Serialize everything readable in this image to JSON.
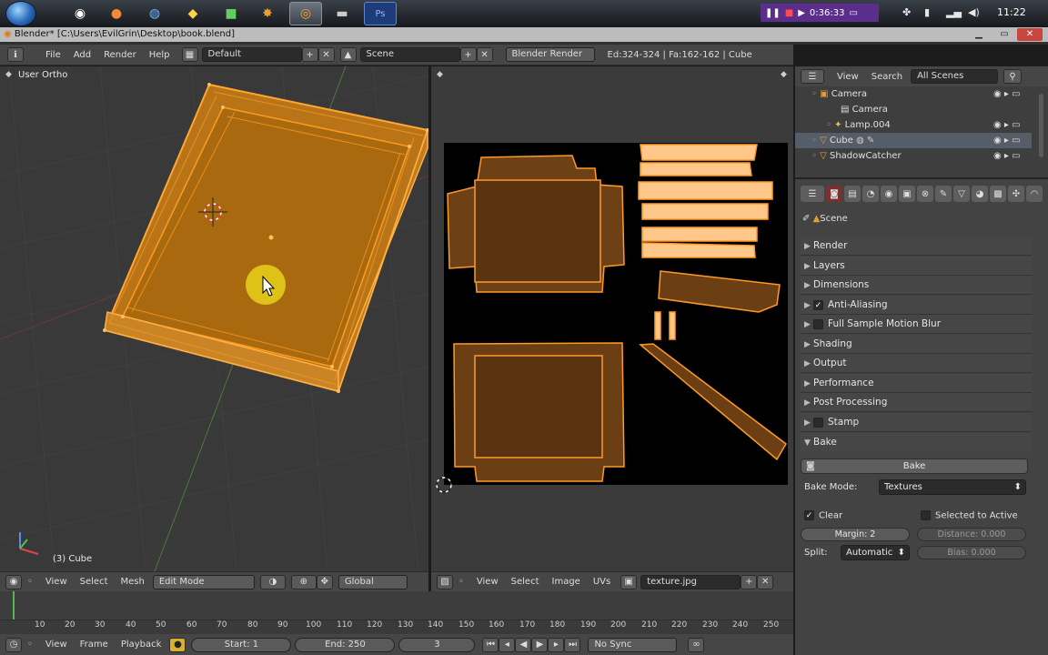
{
  "taskbar": {
    "apps": [
      "chrome-icon",
      "firefox-icon",
      "globe-icon",
      "bing-icon",
      "app-green-icon",
      "settings-app-icon",
      "blender-icon",
      "app-dark-icon",
      "photoshop-icon"
    ],
    "rec_time": "0:36:33",
    "clock": "11:22"
  },
  "window": {
    "title": "Blender* [C:\\Users\\EvilGrin\\Desktop\\book.blend]"
  },
  "info": {
    "menus": [
      "File",
      "Add",
      "Render",
      "Help"
    ],
    "screen": "Default",
    "scene": "Scene",
    "engine": "Blender Render",
    "stats": "Ed:324-324 | Fa:162-162 | Cube"
  },
  "viewport3d": {
    "label": "User Ortho",
    "object_label": "(3) Cube",
    "menus": [
      "View",
      "Select",
      "Mesh"
    ],
    "mode": "Edit Mode",
    "orientation": "Global"
  },
  "uv": {
    "menus": [
      "View",
      "Select",
      "Image",
      "UVs"
    ],
    "image": "texture.jpg"
  },
  "timeline": {
    "ticks": [
      "10",
      "20",
      "30",
      "40",
      "50",
      "60",
      "70",
      "80",
      "90",
      "100",
      "110",
      "120",
      "130",
      "140",
      "150",
      "160",
      "170",
      "180",
      "190",
      "200",
      "210",
      "220",
      "230",
      "240",
      "250"
    ],
    "menus": [
      "View",
      "Frame",
      "Playback"
    ],
    "start": "Start: 1",
    "end": "End: 250",
    "current": "3",
    "sync": "No Sync"
  },
  "outliner": {
    "menus": [
      "View",
      "Search"
    ],
    "filter": "All Scenes",
    "items": [
      "Camera",
      "Camera",
      "Lamp.004",
      "Cube",
      "ShadowCatcher"
    ]
  },
  "properties": {
    "context": "Scene",
    "panels": [
      "Render",
      "Layers",
      "Dimensions",
      "Anti-Aliasing",
      "Full Sample Motion Blur",
      "Shading",
      "Output",
      "Performance",
      "Post Processing",
      "Stamp",
      "Bake"
    ],
    "bake": {
      "button": "Bake",
      "mode_label": "Bake Mode:",
      "mode": "Textures",
      "clear": "Clear",
      "selected_to_active": "Selected to Active",
      "margin": "Margin: 2",
      "distance": "Distance: 0.000",
      "split_label": "Split:",
      "split": "Automatic",
      "bias": "Bias: 0.000"
    }
  }
}
